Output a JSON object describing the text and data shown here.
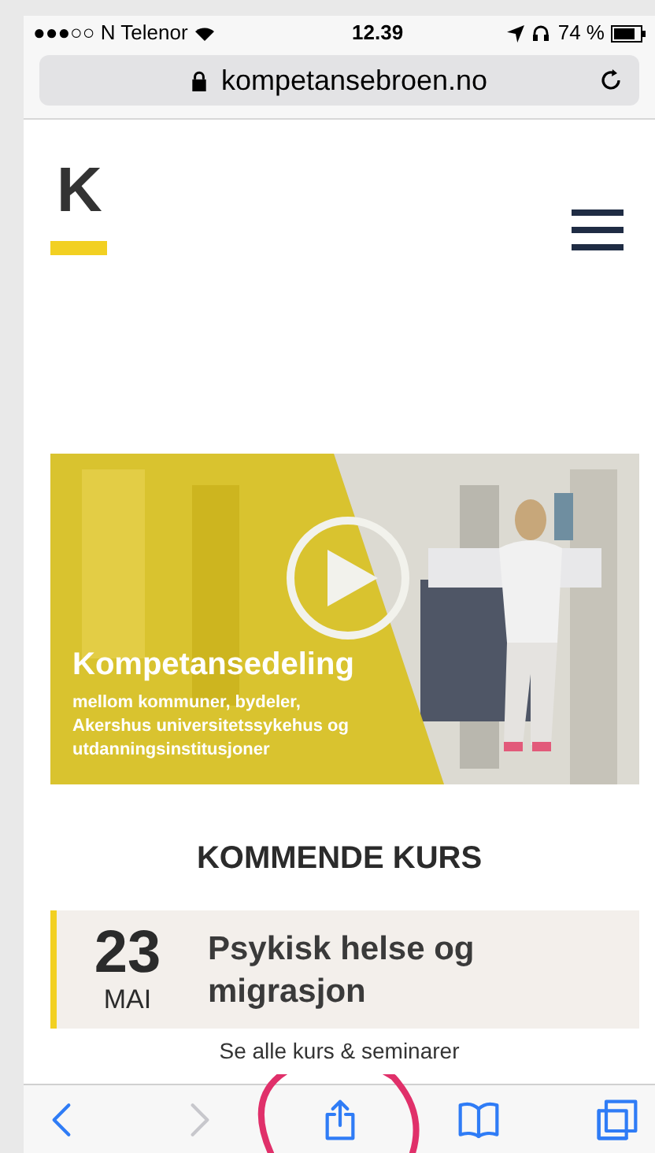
{
  "status_bar": {
    "carrier": "●●●○○ N Telenor",
    "time": "12.39",
    "battery": "74 %"
  },
  "address_bar": {
    "url": "kompetansebroen.no"
  },
  "logo": {
    "letter": "K"
  },
  "video": {
    "title": "Kompetansedeling",
    "subtitle": "mellom kommuner, bydeler, Akershus universitetssykehus og utdanningsinstitusjoner"
  },
  "section_heading": "KOMMENDE KURS",
  "courses": [
    {
      "day": "23",
      "month": "MAI",
      "title": "Psykisk helse og migrasjon"
    }
  ],
  "see_all_link": "Se alle kurs & seminarer",
  "toolbar": [
    {
      "kind": "back",
      "disabled": false
    },
    {
      "kind": "forward",
      "disabled": true
    },
    {
      "kind": "share",
      "disabled": false
    },
    {
      "kind": "bookmarks",
      "disabled": false
    },
    {
      "kind": "tabs",
      "disabled": false
    }
  ]
}
